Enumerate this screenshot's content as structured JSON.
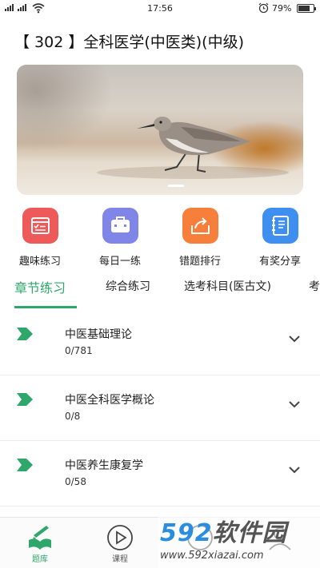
{
  "status_bar": {
    "time": "17:56",
    "battery_percent": "79%",
    "battery_level": 0.79
  },
  "page_title": "【 302 】全科医学(中医类)(中级)",
  "banner": {
    "image": "sandpiper-bird-photo",
    "page_indicator_active": 1
  },
  "quick_actions": [
    {
      "label": "趣味练习",
      "icon": "checklist-icon",
      "color": "#ee5a5a"
    },
    {
      "label": "每日一练",
      "icon": "briefcase-icon",
      "color": "#7f86e8"
    },
    {
      "label": "错题排行",
      "icon": "share-box-icon",
      "color": "#f6803b"
    },
    {
      "label": "有奖分享",
      "icon": "notebook-icon",
      "color": "#3f8ff0"
    }
  ],
  "tabs": [
    {
      "label": "章节练习",
      "active": true
    },
    {
      "label": "综合练习",
      "active": false
    },
    {
      "label": "选考科目(医古文)",
      "active": false
    },
    {
      "label": "考",
      "active": false
    }
  ],
  "chapters": [
    {
      "name": "中医基础理论",
      "progress": "0/781"
    },
    {
      "name": "中医全科医学概论",
      "progress": "0/8"
    },
    {
      "name": "中医养生康复学",
      "progress": "0/58"
    }
  ],
  "bottom_nav": [
    {
      "label": "题库",
      "icon": "book-pen-icon",
      "active": true
    },
    {
      "label": "课程",
      "icon": "play-circle-icon",
      "active": false
    }
  ],
  "watermark": {
    "logo_number": "592",
    "logo_text": "软件园",
    "url": "www.592xiazai.com"
  },
  "colors": {
    "accent_green": "#2fa76a"
  }
}
